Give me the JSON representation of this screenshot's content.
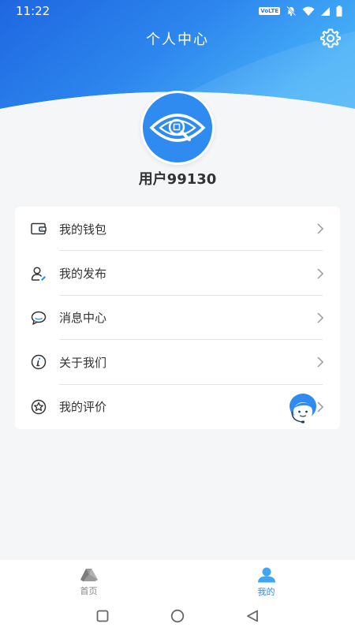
{
  "status_bar": {
    "time": "11:22",
    "volte": "VoLTE"
  },
  "header": {
    "title": "个人中心",
    "gradient_colors": [
      "#1f6fe3",
      "#3ea7f5"
    ]
  },
  "profile": {
    "username": "用户99130",
    "avatar_icon": "eye-logo-icon"
  },
  "menu": {
    "items": [
      {
        "label": "我的钱包",
        "icon": "wallet-icon"
      },
      {
        "label": "我的发布",
        "icon": "user-publish-icon"
      },
      {
        "label": "消息中心",
        "icon": "chat-bubble-icon"
      },
      {
        "label": "关于我们",
        "icon": "info-icon"
      },
      {
        "label": "我的评价",
        "icon": "star-circle-icon"
      }
    ]
  },
  "tabs": [
    {
      "label": "首页",
      "icon": "home-triangle-icon",
      "active": false
    },
    {
      "label": "我的",
      "icon": "person-icon",
      "active": true
    }
  ],
  "colors": {
    "accent": "#2f8bf0",
    "text_primary": "#333333",
    "background": "#f5f6f8"
  }
}
